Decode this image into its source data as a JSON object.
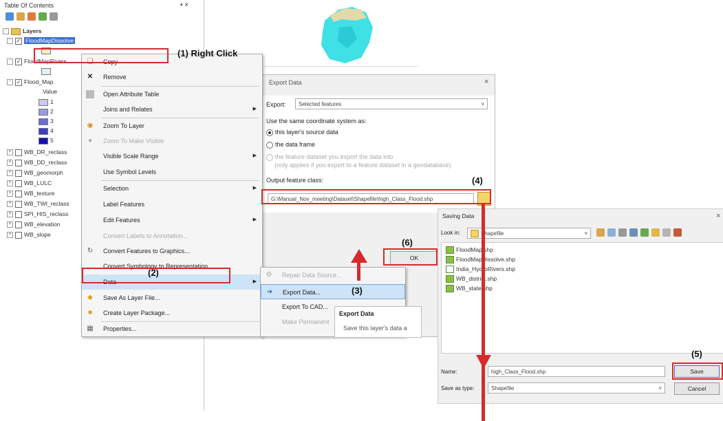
{
  "toc": {
    "title": "Table Of Contents",
    "pin": " •×",
    "layers_root": "Layers",
    "selected_layer": "FloodMapDissolve",
    "rows": [
      {
        "label": "FloodMapDissolve",
        "checked": true
      },
      {
        "label": "FloodMapRivers",
        "checked": true
      },
      {
        "label": "Flood_Map",
        "checked": true
      },
      {
        "label": "Value"
      },
      {
        "label": "1"
      },
      {
        "label": "2"
      },
      {
        "label": "3"
      },
      {
        "label": "4"
      },
      {
        "label": "5"
      },
      {
        "label": "WB_DR_reclass",
        "checked": false
      },
      {
        "label": "WB_DD_reclass",
        "checked": false
      },
      {
        "label": "WB_geomorph",
        "checked": false
      },
      {
        "label": "WB_LULC",
        "checked": false
      },
      {
        "label": "WB_texture",
        "checked": false
      },
      {
        "label": "WB_TWI_reclass",
        "checked": false
      },
      {
        "label": "SPI_HIS_reclass",
        "checked": false
      },
      {
        "label": "WB_elevation",
        "checked": false
      },
      {
        "label": "WB_slope",
        "checked": false
      }
    ],
    "swatch_colors": [
      "#c9c9ef",
      "#9a9ae0",
      "#6c6cd4",
      "#3d3dc6",
      "#1212b2"
    ]
  },
  "annotations": {
    "a1": "(1) Right Click",
    "a2": "(2)",
    "a3": "(3)",
    "a4": "(4)",
    "a5": "(5)",
    "a6": "(6)"
  },
  "context_menu": {
    "items": [
      {
        "label": "Copy",
        "icon": "copy-icon",
        "disabled": false
      },
      {
        "label": "Remove",
        "icon": "remove-icon"
      },
      {
        "label": "Open Attribute Table",
        "icon": "table-icon"
      },
      {
        "label": "Joins and Relates",
        "submenu": true
      },
      {
        "label": "Zoom To Layer",
        "icon": "zoom-icon"
      },
      {
        "label": "Zoom To Make Visible",
        "disabled": true
      },
      {
        "label": "Visible Scale Range",
        "submenu": true
      },
      {
        "label": "Use Symbol Levels"
      },
      {
        "label": "Selection",
        "submenu": true
      },
      {
        "label": "Label Features"
      },
      {
        "label": "Edit Features",
        "submenu": true
      },
      {
        "label": "Convert Labels to Annotation...",
        "disabled": true
      },
      {
        "label": "Convert Features to Graphics..."
      },
      {
        "label": "Convert Symbology to Representation..."
      },
      {
        "label": "Data",
        "submenu": true
      },
      {
        "label": "Save As Layer File..."
      },
      {
        "label": "Create Layer Package..."
      },
      {
        "label": "Properties..."
      }
    ]
  },
  "data_submenu": {
    "items": [
      {
        "label": "Repair Data Source...",
        "disabled": true
      },
      {
        "label": "Export Data..."
      },
      {
        "label": "Export To CAD..."
      },
      {
        "label": "Make Permanent",
        "disabled": true
      }
    ],
    "tooltip_title": "Export Data",
    "tooltip_text": "Save this layer's data a"
  },
  "export_dialog": {
    "title": "Export Data",
    "close": "×",
    "export_label": "Export:",
    "export_value": "Selected features",
    "coord_label": "Use the same coordinate system as:",
    "radio1": "this layer's source data",
    "radio2": "the data frame",
    "radio3a": "the feature dataset you export the data into",
    "radio3b": "(only applies if you export to a feature dataset in a geodatabase)",
    "output_label": "Output feature class:",
    "output_value": "G:\\Manual_Nov_meeting\\Dataset\\Shapefile\\high_Class_Flood.shp",
    "ok": "OK"
  },
  "save_dialog": {
    "title": "Saving Data",
    "close": "×",
    "lookin_label": "Look in:",
    "lookin_value": "Shapefile",
    "files": [
      "FloodMap.shp",
      "FloodMapDissolve.shp",
      "India_HydroRivers.shp",
      "WB_district.shp",
      "WB_state.shp"
    ],
    "name_label": "Name:",
    "name_value": "high_Class_Flood.shp",
    "type_label": "Save as type:",
    "type_value": "Shapefile",
    "save": "Save",
    "cancel": "Cancel"
  }
}
